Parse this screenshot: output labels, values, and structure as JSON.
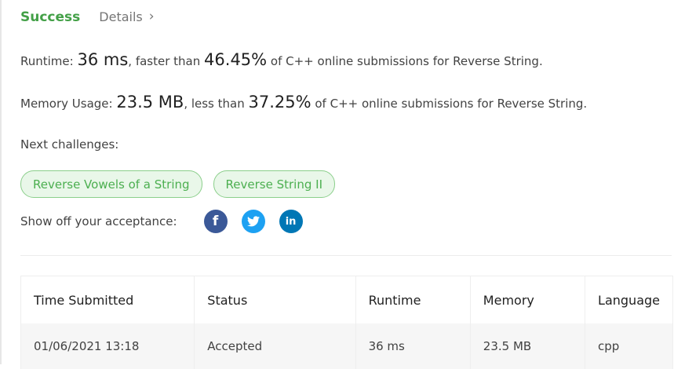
{
  "header": {
    "status": "Success",
    "details_label": "Details",
    "chevron": "›"
  },
  "runtime": {
    "label": "Runtime:",
    "value": "36 ms",
    "comparison": ", faster than",
    "percent": "46.45%",
    "suffix": "of C++ online submissions for Reverse String."
  },
  "memory": {
    "label": "Memory Usage:",
    "value": "23.5 MB",
    "comparison": ", less than",
    "percent": "37.25%",
    "suffix": "of C++ online submissions for Reverse String."
  },
  "next": {
    "label": "Next challenges:",
    "items": [
      "Reverse Vowels of a String",
      "Reverse String II"
    ]
  },
  "share": {
    "label": "Show off your acceptance:",
    "icons": {
      "facebook": "f",
      "twitter": "twitter-bird-icon",
      "linkedin": "in"
    },
    "colors": {
      "facebook": "#3b5998",
      "twitter": "#1da1f2",
      "linkedin": "#0077b5"
    }
  },
  "submissions": {
    "columns": [
      "Time Submitted",
      "Status",
      "Runtime",
      "Memory",
      "Language"
    ],
    "rows": [
      [
        "01/06/2021 13:18",
        "Accepted",
        "36 ms",
        "23.5 MB",
        "cpp"
      ]
    ]
  },
  "colors": {
    "accent": "#43a047",
    "chip_bg": "#e9f7e9",
    "chip_border": "#8bcf8b"
  }
}
